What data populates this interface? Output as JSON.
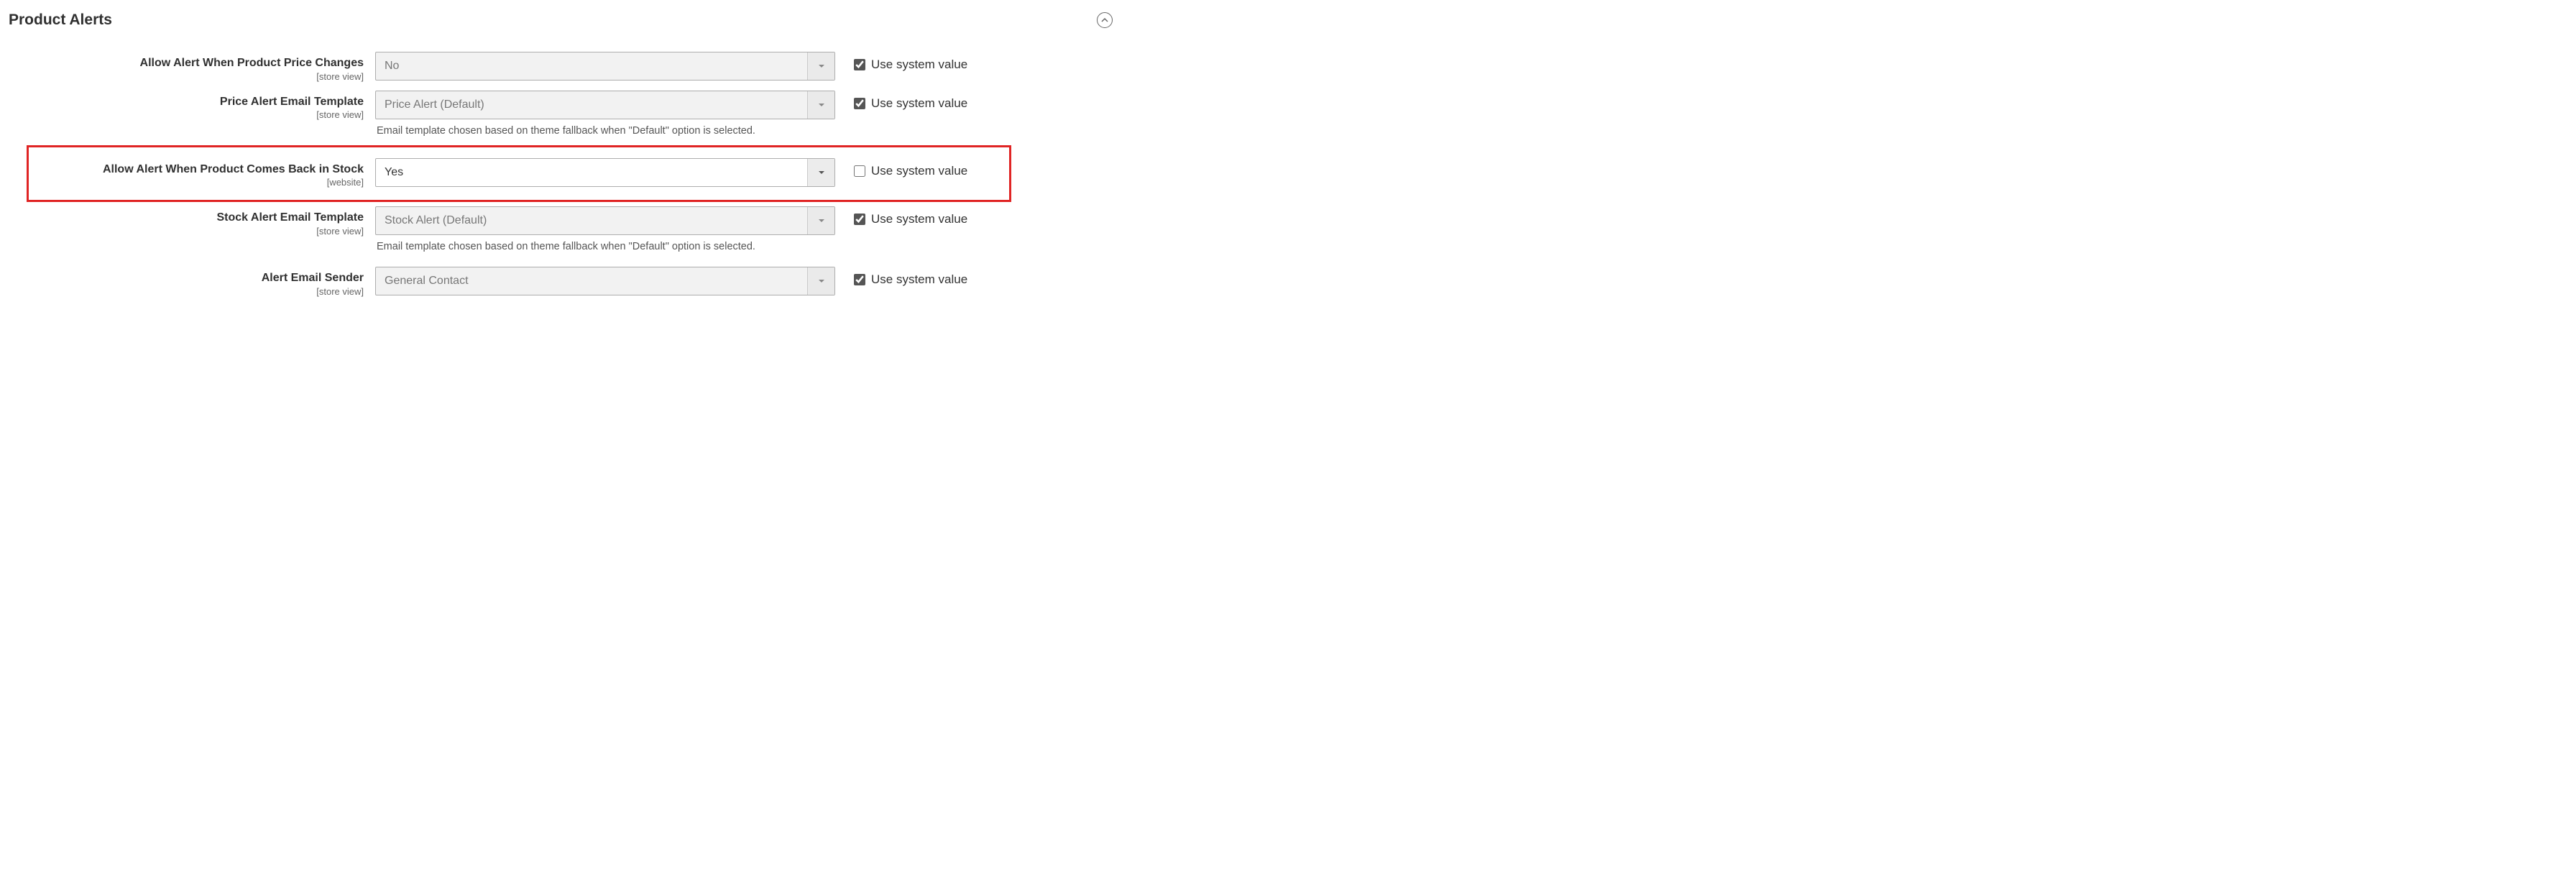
{
  "section": {
    "title": "Product Alerts"
  },
  "common": {
    "scope_store": "[store view]",
    "scope_website": "[website]",
    "use_system_value": "Use system value",
    "template_help": "Email template chosen based on theme fallback when \"Default\" option is selected."
  },
  "fields": {
    "price_change": {
      "label": "Allow Alert When Product Price Changes",
      "value": "No"
    },
    "price_template": {
      "label": "Price Alert Email Template",
      "value": "Price Alert (Default)"
    },
    "back_in_stock": {
      "label": "Allow Alert When Product Comes Back in Stock",
      "value": "Yes"
    },
    "stock_template": {
      "label": "Stock Alert Email Template",
      "value": "Stock Alert (Default)"
    },
    "sender": {
      "label": "Alert Email Sender",
      "value": "General Contact"
    }
  }
}
